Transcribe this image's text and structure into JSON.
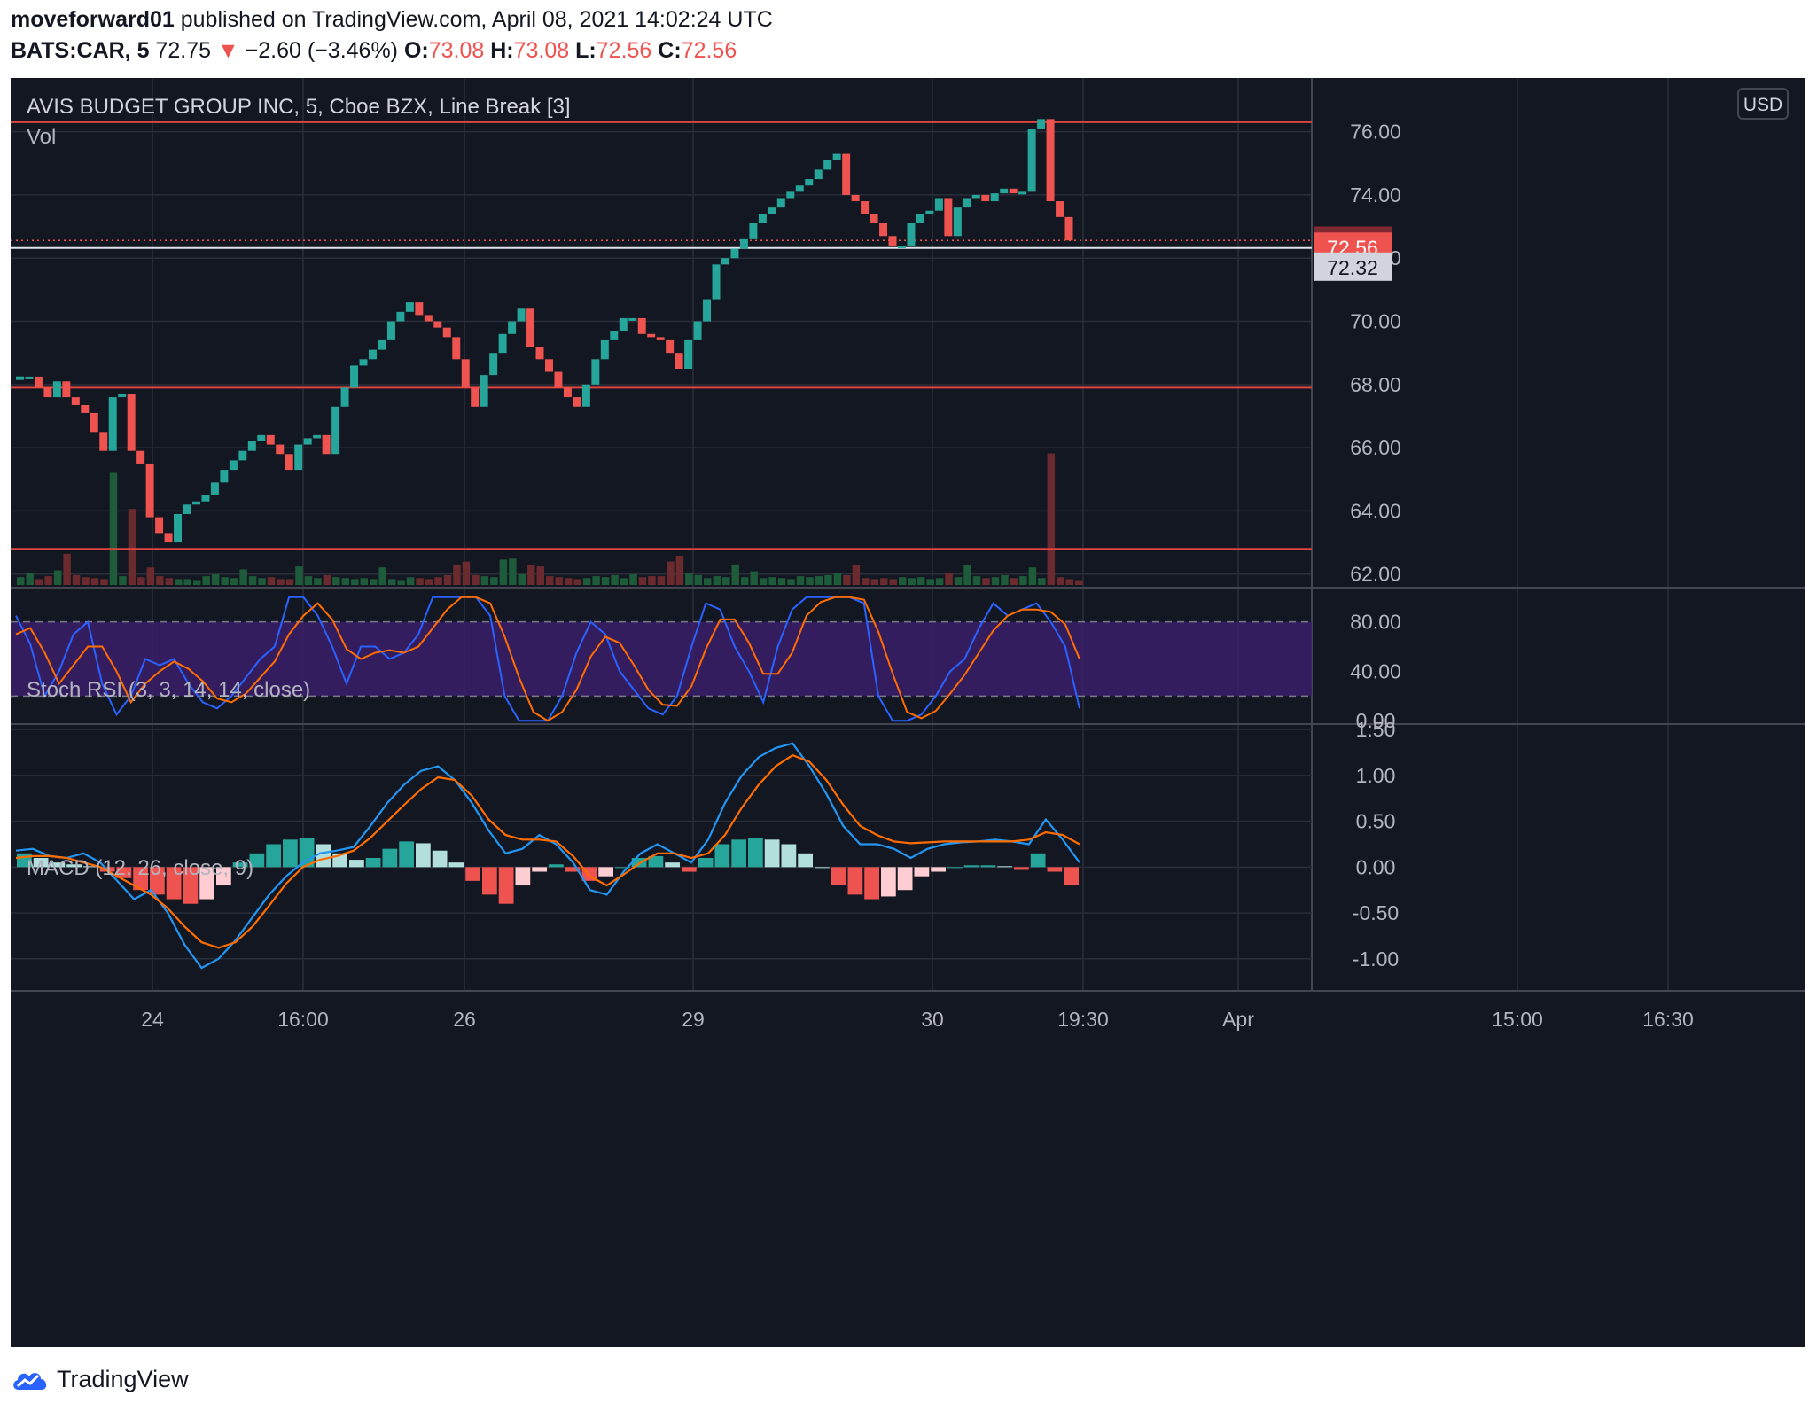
{
  "header": {
    "author": "moveforward01",
    "published": "published on TradingView.com, April 08, 2021 14:02:24 UTC",
    "symbol": "BATS:CAR, 5",
    "last": "72.75",
    "arrow": "▼",
    "change": "−2.60 (−3.46%)",
    "o_label": "O:",
    "o": "73.08",
    "h_label": "H:",
    "h": "73.08",
    "l_label": "L:",
    "l": "72.56",
    "c_label": "C:",
    "c": "72.56"
  },
  "footer": {
    "brand": "TradingView",
    "logo_icon": "tradingview-cloud-logo"
  },
  "colors": {
    "bg": "#131722",
    "up": "#26a69a",
    "down": "#ef5350",
    "grid": "#2a2e39",
    "text": "#b2b5be",
    "macd": "#2196f3",
    "signal": "#ff6d00",
    "band": "#7e57c2"
  },
  "currency": "USD",
  "chart_data": [
    {
      "type": "line_break",
      "title": "AVIS BUDGET GROUP INC, 5, Cboe BZX, Line Break [3]",
      "sublabel": "Vol",
      "y_ticks": [
        "76.00",
        "74.00",
        "72.00",
        "70.00",
        "68.00",
        "66.00",
        "64.00",
        "62.00"
      ],
      "ylim": [
        61.6,
        77.7
      ],
      "x_ticks": [
        "24",
        "16:00",
        "26",
        "29",
        "30",
        "19:30",
        "Apr",
        "15:00",
        "16:30"
      ],
      "price_tags": [
        {
          "value": 72.75,
          "label": "72.75",
          "color": "#7f2a32"
        },
        {
          "value": 72.56,
          "label": "72.56",
          "color": "#ef5350"
        },
        {
          "value": 72.32,
          "label": "72.32",
          "color": "#d1d4dc"
        }
      ],
      "horizontal_levels": [
        76.3,
        67.9,
        62.8
      ],
      "closes": [
        68.2,
        68.25,
        67.9,
        67.6,
        68.1,
        67.6,
        67.35,
        67.1,
        66.5,
        65.9,
        67.6,
        67.7,
        65.9,
        65.5,
        63.8,
        63.3,
        63.0,
        63.9,
        64.2,
        64.3,
        64.5,
        64.9,
        65.3,
        65.6,
        65.9,
        66.2,
        66.4,
        66.1,
        65.8,
        65.3,
        66.1,
        66.3,
        66.4,
        65.8,
        67.3,
        67.9,
        68.6,
        68.8,
        69.1,
        69.4,
        70.0,
        70.3,
        70.6,
        70.2,
        70.0,
        69.8,
        69.5,
        68.8,
        67.9,
        67.3,
        68.3,
        69.0,
        69.6,
        70.0,
        70.4,
        69.2,
        68.8,
        68.4,
        67.9,
        67.6,
        67.3,
        68.0,
        68.8,
        69.4,
        69.7,
        70.1,
        70.1,
        69.6,
        69.5,
        69.4,
        69.0,
        68.5,
        69.4,
        70.0,
        70.7,
        71.8,
        72.0,
        72.3,
        72.6,
        73.1,
        73.4,
        73.6,
        73.9,
        74.1,
        74.3,
        74.5,
        74.8,
        75.1,
        75.3,
        74.0,
        73.8,
        73.4,
        73.1,
        72.7,
        72.4,
        72.4,
        73.1,
        73.4,
        73.5,
        73.9,
        72.7,
        73.6,
        73.9,
        74.0,
        73.8,
        74.05,
        74.2,
        74.05,
        74.1,
        76.1,
        76.4,
        73.8,
        73.3,
        72.56
      ],
      "volume": [
        0.8,
        1.2,
        0.6,
        0.9,
        1.5,
        3.2,
        1.0,
        0.8,
        0.7,
        0.6,
        11.5,
        0.9,
        7.8,
        0.8,
        1.8,
        0.9,
        0.7,
        0.6,
        0.6,
        0.5,
        0.9,
        1.1,
        0.8,
        0.7,
        1.6,
        0.9,
        0.7,
        0.8,
        0.6,
        0.6,
        1.9,
        0.9,
        0.7,
        1.0,
        0.8,
        0.7,
        0.6,
        0.7,
        0.6,
        1.8,
        0.6,
        0.5,
        0.8,
        0.7,
        0.6,
        0.8,
        1.0,
        2.1,
        2.4,
        1.0,
        0.9,
        0.8,
        2.6,
        2.7,
        1.1,
        2.0,
        1.9,
        0.9,
        0.8,
        0.7,
        0.6,
        0.7,
        0.9,
        0.8,
        1.0,
        0.7,
        1.1,
        0.8,
        0.9,
        0.9,
        2.4,
        3.0,
        1.2,
        1.0,
        0.7,
        0.9,
        0.8,
        2.1,
        0.8,
        1.4,
        0.7,
        0.8,
        0.7,
        0.6,
        0.9,
        0.8,
        0.9,
        1.0,
        1.2,
        1.0,
        2.0,
        0.7,
        0.6,
        0.7,
        0.6,
        0.8,
        0.7,
        0.8,
        0.6,
        0.7,
        1.2,
        0.8,
        2.0,
        0.9,
        0.7,
        0.8,
        1.0,
        0.7,
        0.9,
        1.8,
        0.7,
        13.5,
        0.8,
        0.6,
        0.5
      ]
    },
    {
      "type": "line",
      "title": "Stoch RSI (3, 3, 14, 14, close)",
      "y_ticks": [
        "80.00",
        "40.00",
        "0.00"
      ],
      "ylim": [
        -2,
        107
      ],
      "band": [
        20,
        80
      ],
      "series": [
        {
          "role": "k",
          "color": "#2962ff",
          "values": [
            85,
            62,
            20,
            40,
            70,
            80,
            30,
            5,
            20,
            50,
            45,
            50,
            30,
            15,
            10,
            20,
            35,
            50,
            60,
            100,
            100,
            85,
            60,
            30,
            60,
            60,
            50,
            55,
            70,
            100,
            100,
            100,
            100,
            85,
            20,
            0,
            0,
            0,
            20,
            55,
            80,
            70,
            40,
            25,
            10,
            5,
            20,
            60,
            95,
            90,
            60,
            40,
            15,
            60,
            90,
            100,
            100,
            100,
            100,
            95,
            20,
            0,
            0,
            5,
            20,
            40,
            50,
            75,
            95,
            85,
            90,
            95,
            80,
            60,
            10
          ]
        },
        {
          "role": "d",
          "color": "#ff6d00",
          "values": [
            70,
            75,
            55,
            30,
            45,
            60,
            60,
            40,
            15,
            30,
            40,
            48,
            42,
            32,
            18,
            15,
            22,
            35,
            48,
            70,
            85,
            95,
            82,
            58,
            50,
            55,
            57,
            55,
            60,
            75,
            90,
            100,
            100,
            95,
            68,
            35,
            7,
            0,
            7,
            25,
            52,
            68,
            63,
            45,
            25,
            13,
            12,
            28,
            58,
            82,
            82,
            63,
            38,
            38,
            55,
            85,
            96,
            100,
            100,
            98,
            72,
            38,
            7,
            2,
            8,
            22,
            37,
            55,
            73,
            85,
            90,
            90,
            88,
            78,
            50
          ]
        }
      ]
    },
    {
      "type": "line",
      "title": "MACD (12, 26, close, 9)",
      "y_ticks": [
        "1.50",
        "1.00",
        "0.50",
        "0.00",
        "-0.50",
        "-1.00"
      ],
      "ylim": [
        -1.35,
        1.55
      ],
      "series": [
        {
          "role": "macd",
          "color": "#2196f3",
          "values": [
            0.18,
            0.2,
            0.12,
            0.1,
            0.15,
            0.05,
            -0.15,
            -0.35,
            -0.25,
            -0.5,
            -0.85,
            -1.1,
            -1.0,
            -0.8,
            -0.55,
            -0.3,
            -0.1,
            0.05,
            0.15,
            0.18,
            0.22,
            0.45,
            0.7,
            0.9,
            1.05,
            1.1,
            0.95,
            0.7,
            0.4,
            0.15,
            0.2,
            0.35,
            0.25,
            0.05,
            -0.25,
            -0.3,
            -0.05,
            0.15,
            0.25,
            0.15,
            0.05,
            0.3,
            0.7,
            1.0,
            1.2,
            1.3,
            1.35,
            1.1,
            0.8,
            0.45,
            0.25,
            0.25,
            0.2,
            0.1,
            0.2,
            0.25,
            0.27,
            0.28,
            0.3,
            0.28,
            0.25,
            0.52,
            0.3,
            0.05
          ]
        },
        {
          "role": "signal",
          "color": "#ff6d00",
          "values": [
            0.1,
            0.12,
            0.12,
            0.1,
            0.05,
            0.0,
            -0.1,
            -0.2,
            -0.3,
            -0.45,
            -0.65,
            -0.82,
            -0.88,
            -0.82,
            -0.65,
            -0.42,
            -0.18,
            0.0,
            0.08,
            0.12,
            0.18,
            0.32,
            0.5,
            0.68,
            0.85,
            0.98,
            0.95,
            0.78,
            0.52,
            0.35,
            0.3,
            0.3,
            0.28,
            0.12,
            -0.1,
            -0.2,
            -0.08,
            0.05,
            0.15,
            0.15,
            0.1,
            0.15,
            0.35,
            0.65,
            0.9,
            1.1,
            1.22,
            1.15,
            0.95,
            0.68,
            0.45,
            0.35,
            0.28,
            0.26,
            0.27,
            0.28,
            0.28,
            0.28,
            0.28,
            0.28,
            0.3,
            0.38,
            0.35,
            0.25
          ]
        },
        {
          "role": "histogram",
          "values": [
            0.15,
            0.1,
            0.05,
            0.03,
            0.01,
            -0.05,
            -0.12,
            -0.25,
            -0.3,
            -0.35,
            -0.4,
            -0.35,
            -0.2,
            0.05,
            0.15,
            0.25,
            0.3,
            0.32,
            0.25,
            0.15,
            0.08,
            0.1,
            0.2,
            0.28,
            0.26,
            0.18,
            0.05,
            -0.15,
            -0.3,
            -0.4,
            -0.2,
            -0.05,
            0.03,
            -0.05,
            -0.15,
            -0.1,
            0.0,
            0.1,
            0.12,
            0.05,
            -0.05,
            0.1,
            0.25,
            0.3,
            0.32,
            0.3,
            0.25,
            0.15,
            0.0,
            -0.2,
            -0.3,
            -0.35,
            -0.32,
            -0.25,
            -0.1,
            -0.05,
            0.0,
            0.02,
            0.02,
            0.01,
            -0.03,
            0.15,
            -0.05,
            -0.2
          ]
        }
      ]
    }
  ]
}
